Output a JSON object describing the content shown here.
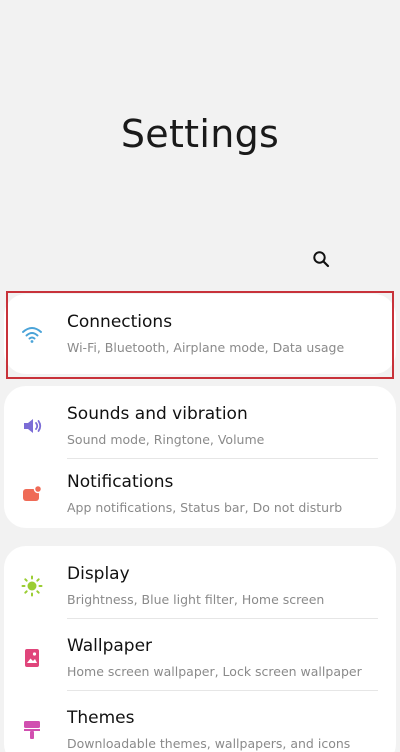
{
  "header": {
    "title": "Settings"
  },
  "colors": {
    "background": "#f2f2f2",
    "card": "#ffffff",
    "highlight": "#c8323a",
    "wifi_icon": "#4aa3d8",
    "sound_icon": "#7b6cd6",
    "notification_icon": "#ef6b57",
    "display_icon": "#9acd32",
    "wallpaper_icon": "#e0457b",
    "themes_icon": "#d14fb0"
  },
  "settings": {
    "connections": {
      "title": "Connections",
      "subtitle": "Wi-Fi, Bluetooth, Airplane mode, Data usage",
      "icon": "wifi-icon"
    },
    "sounds": {
      "title": "Sounds and vibration",
      "subtitle": "Sound mode, Ringtone, Volume",
      "icon": "speaker-icon"
    },
    "notifications": {
      "title": "Notifications",
      "subtitle": "App notifications, Status bar, Do not disturb",
      "icon": "notification-icon"
    },
    "display": {
      "title": "Display",
      "subtitle": "Brightness, Blue light filter, Home screen",
      "icon": "brightness-icon"
    },
    "wallpaper": {
      "title": "Wallpaper",
      "subtitle": "Home screen wallpaper, Lock screen wallpaper",
      "icon": "wallpaper-icon"
    },
    "themes": {
      "title": "Themes",
      "subtitle": "Downloadable themes, wallpapers, and icons",
      "icon": "paintbrush-icon"
    }
  }
}
